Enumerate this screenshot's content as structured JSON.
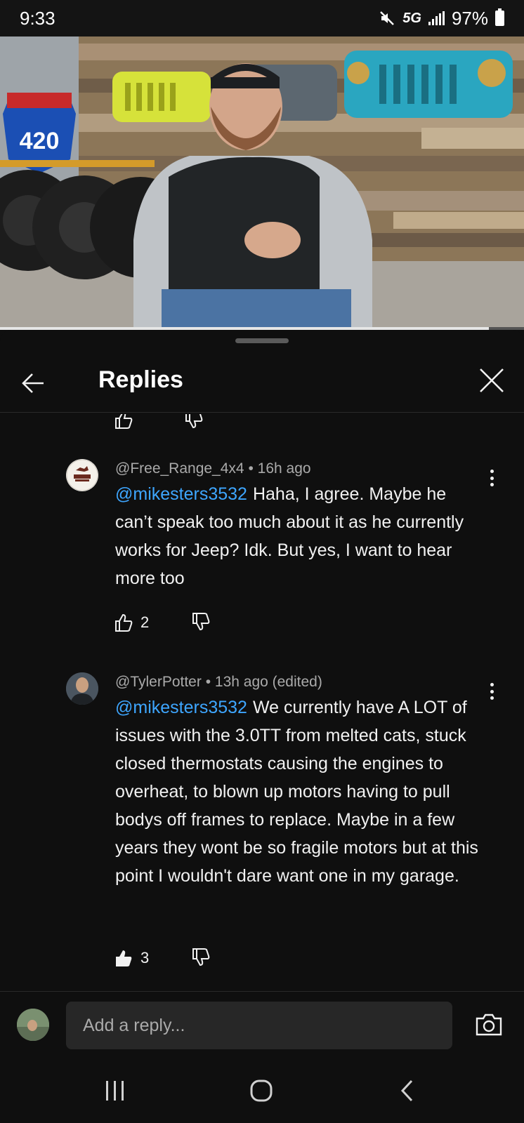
{
  "status": {
    "time": "9:33",
    "network": "5G",
    "battery": "97%"
  },
  "sheet": {
    "title": "Replies"
  },
  "comments": [
    {
      "author": "@Free_Range_4x4",
      "time": "16h ago",
      "mention": "@mikesters3532",
      "text": "Haha, I agree. Maybe he can’t speak too much about it as he currently works for Jeep? Idk. But yes, I want to hear more too",
      "likes": "2"
    },
    {
      "author": "@TylerPotter",
      "time": "13h ago (edited)",
      "mention": "@mikesters3532",
      "text": "We currently have A LOT of issues with the 3.0TT from melted cats, stuck closed thermostats causing the engines to overheat, to blown up motors having to pull bodys off frames to replace. Maybe in a few years they wont be so fragile motors but at this point I wouldn't dare want one in my garage.",
      "likes": "3"
    }
  ],
  "reply": {
    "placeholder": "Add a reply..."
  },
  "video": {
    "sign_number": "420"
  }
}
